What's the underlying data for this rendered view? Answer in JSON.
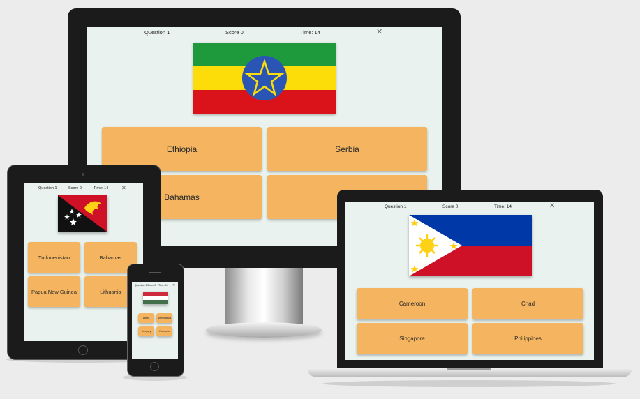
{
  "devices": {
    "desktop": {
      "question": "Question 1",
      "score": "Score 0",
      "time": "Time: 14",
      "close": "✕",
      "options": [
        "Ethiopia",
        "Serbia",
        "Bahamas",
        "Ba"
      ]
    },
    "laptop": {
      "question": "Question 1",
      "score": "Score 0",
      "time": "Time: 14",
      "close": "✕",
      "options": [
        "Cameroon",
        "Chad",
        "Singapore",
        "Philippines"
      ]
    },
    "tablet": {
      "question": "Question 1",
      "score": "Score 0",
      "time": "Time: 14",
      "close": "✕",
      "options": [
        "Turkmenistan",
        "Bahamas",
        "Papua New Guinea",
        "Lithuania"
      ]
    },
    "phone": {
      "question": "Question 1",
      "score": "Score 0",
      "time": "Time: 14",
      "close": "✕",
      "options": [
        "Latvia",
        "Netherlands",
        "Hungary",
        "Romania"
      ]
    }
  },
  "colors": {
    "option_bg": "#f4b460",
    "screen_bg": "#e9f2ee",
    "bezel": "#1b1b1b"
  },
  "flags": {
    "desktop": "ethiopia-flag",
    "laptop": "philippines-flag",
    "tablet": "papua-new-guinea-flag",
    "phone": "hungary-flag"
  }
}
